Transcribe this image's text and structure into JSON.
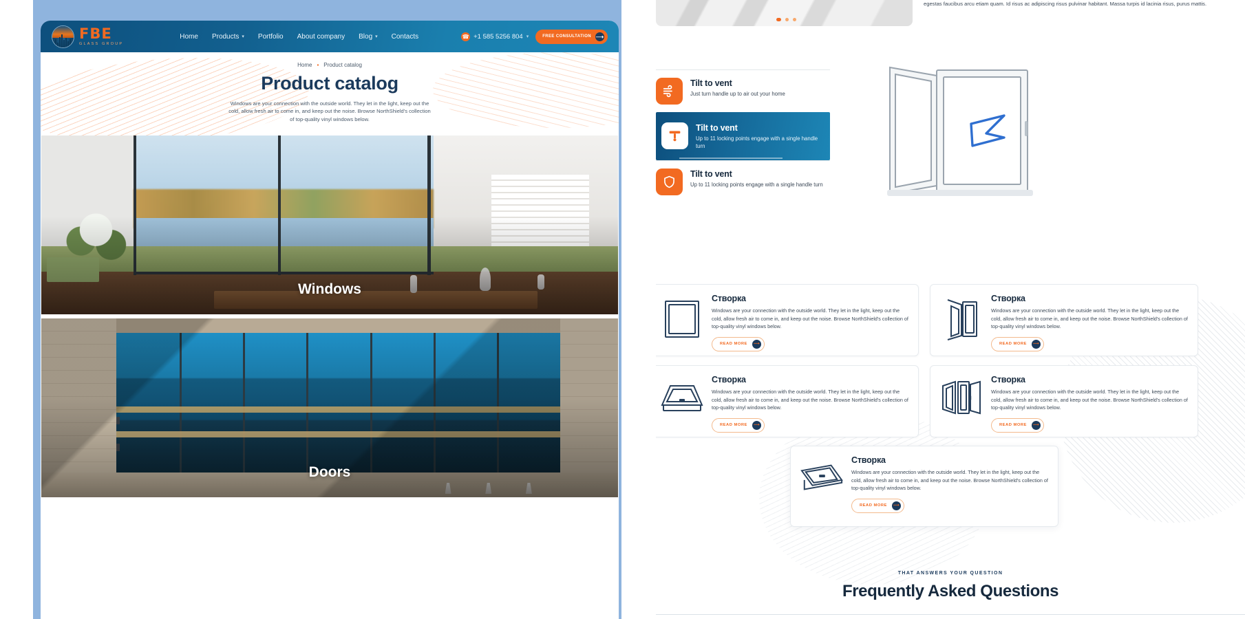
{
  "site": {
    "logo_mark": "FBE",
    "logo_sub": "GLASS GROUP",
    "nav": [
      {
        "label": "Home",
        "has_caret": false
      },
      {
        "label": "Products",
        "has_caret": true
      },
      {
        "label": "Portfolio",
        "has_caret": false
      },
      {
        "label": "About company",
        "has_caret": false
      },
      {
        "label": "Blog",
        "has_caret": true
      },
      {
        "label": "Contacts",
        "has_caret": false
      }
    ],
    "phone": "+1 585 5256 804",
    "phone_caret": "⌄",
    "consult_button": "FREE CONSULTATION",
    "consult_arrow": "→"
  },
  "breadcrumb": {
    "home": "Home",
    "separator": "▪",
    "current": "Product catalog"
  },
  "page": {
    "title": "Product catalog",
    "description": "Windows are your connection with the outside world. They let in the light, keep out the cold, allow fresh air to come in, and keep out the noise. Browse NorthShield's collection of top-quality vinyl windows below."
  },
  "categories": [
    {
      "label": "Windows"
    },
    {
      "label": "Doors"
    }
  ],
  "right": {
    "intro_paragraph": "egestas faucibus arcu etiam quam. Id risus ac adipiscing risus pulvinar habitant. Massa turpis id lacinia risus, purus mattis.",
    "carousel_dots": 3,
    "carousel_active_index": 0,
    "features": [
      {
        "title": "Tilt to vent",
        "desc": "Just turn handle up to air out your home",
        "icon": "wind-icon",
        "active": false
      },
      {
        "title": "Tilt to vent",
        "desc": "Up to 11 locking points engage with a single handle turn",
        "icon": "squeegee-icon",
        "active": true
      },
      {
        "title": "Tilt to vent",
        "desc": "Up to 11 locking points engage with a single handle turn",
        "icon": "shield-icon",
        "active": false
      }
    ],
    "cards": [
      {
        "title": "Створка",
        "desc": "Windows are your connection with the outside world. They let in the light, keep out the cold, allow fresh air to come in, and keep out the noise. Browse NorthShield's collection of top-quality vinyl windows below.",
        "button": "READ MORE",
        "icon": "fixed-window-icon"
      },
      {
        "title": "Створка",
        "desc": "Windows are your connection with the outside world. They let in the light, keep out the cold, allow fresh air to come in, and keep out the noise. Browse NorthShield's collection of top-quality vinyl windows below.",
        "button": "READ MORE",
        "icon": "casement-window-icon"
      },
      {
        "title": "Створка",
        "desc": "Windows are your connection with the outside world. They let in the light, keep out the cold, allow fresh air to come in, and keep out the noise. Browse NorthShield's collection of top-quality vinyl windows below.",
        "button": "READ MORE",
        "icon": "awning-window-icon"
      },
      {
        "title": "Створка",
        "desc": "Windows are your connection with the outside world. They let in the light, keep out the cold, allow fresh air to come in, and keep out the noise. Browse NorthShield's collection of top-quality vinyl windows below.",
        "button": "READ MORE",
        "icon": "double-casement-icon"
      },
      {
        "title": "Створка",
        "desc": "Windows are your connection with the outside world. They let in the light, keep out the cold, allow fresh air to come in, and keep out the noise. Browse NorthShield's collection of top-quality vinyl windows below.",
        "button": "READ MORE",
        "icon": "hopper-window-icon"
      }
    ],
    "faq": {
      "kicker": "THAT ANSWERS YOUR QUESTION",
      "title": "Frequently Asked Questions"
    }
  },
  "colors": {
    "accent_orange": "#f26a21",
    "deep_navy": "#16293d",
    "header_blue_start": "#0d4f7d",
    "header_blue_end": "#1d86b6",
    "page_outer_blue": "#8fb4de"
  }
}
